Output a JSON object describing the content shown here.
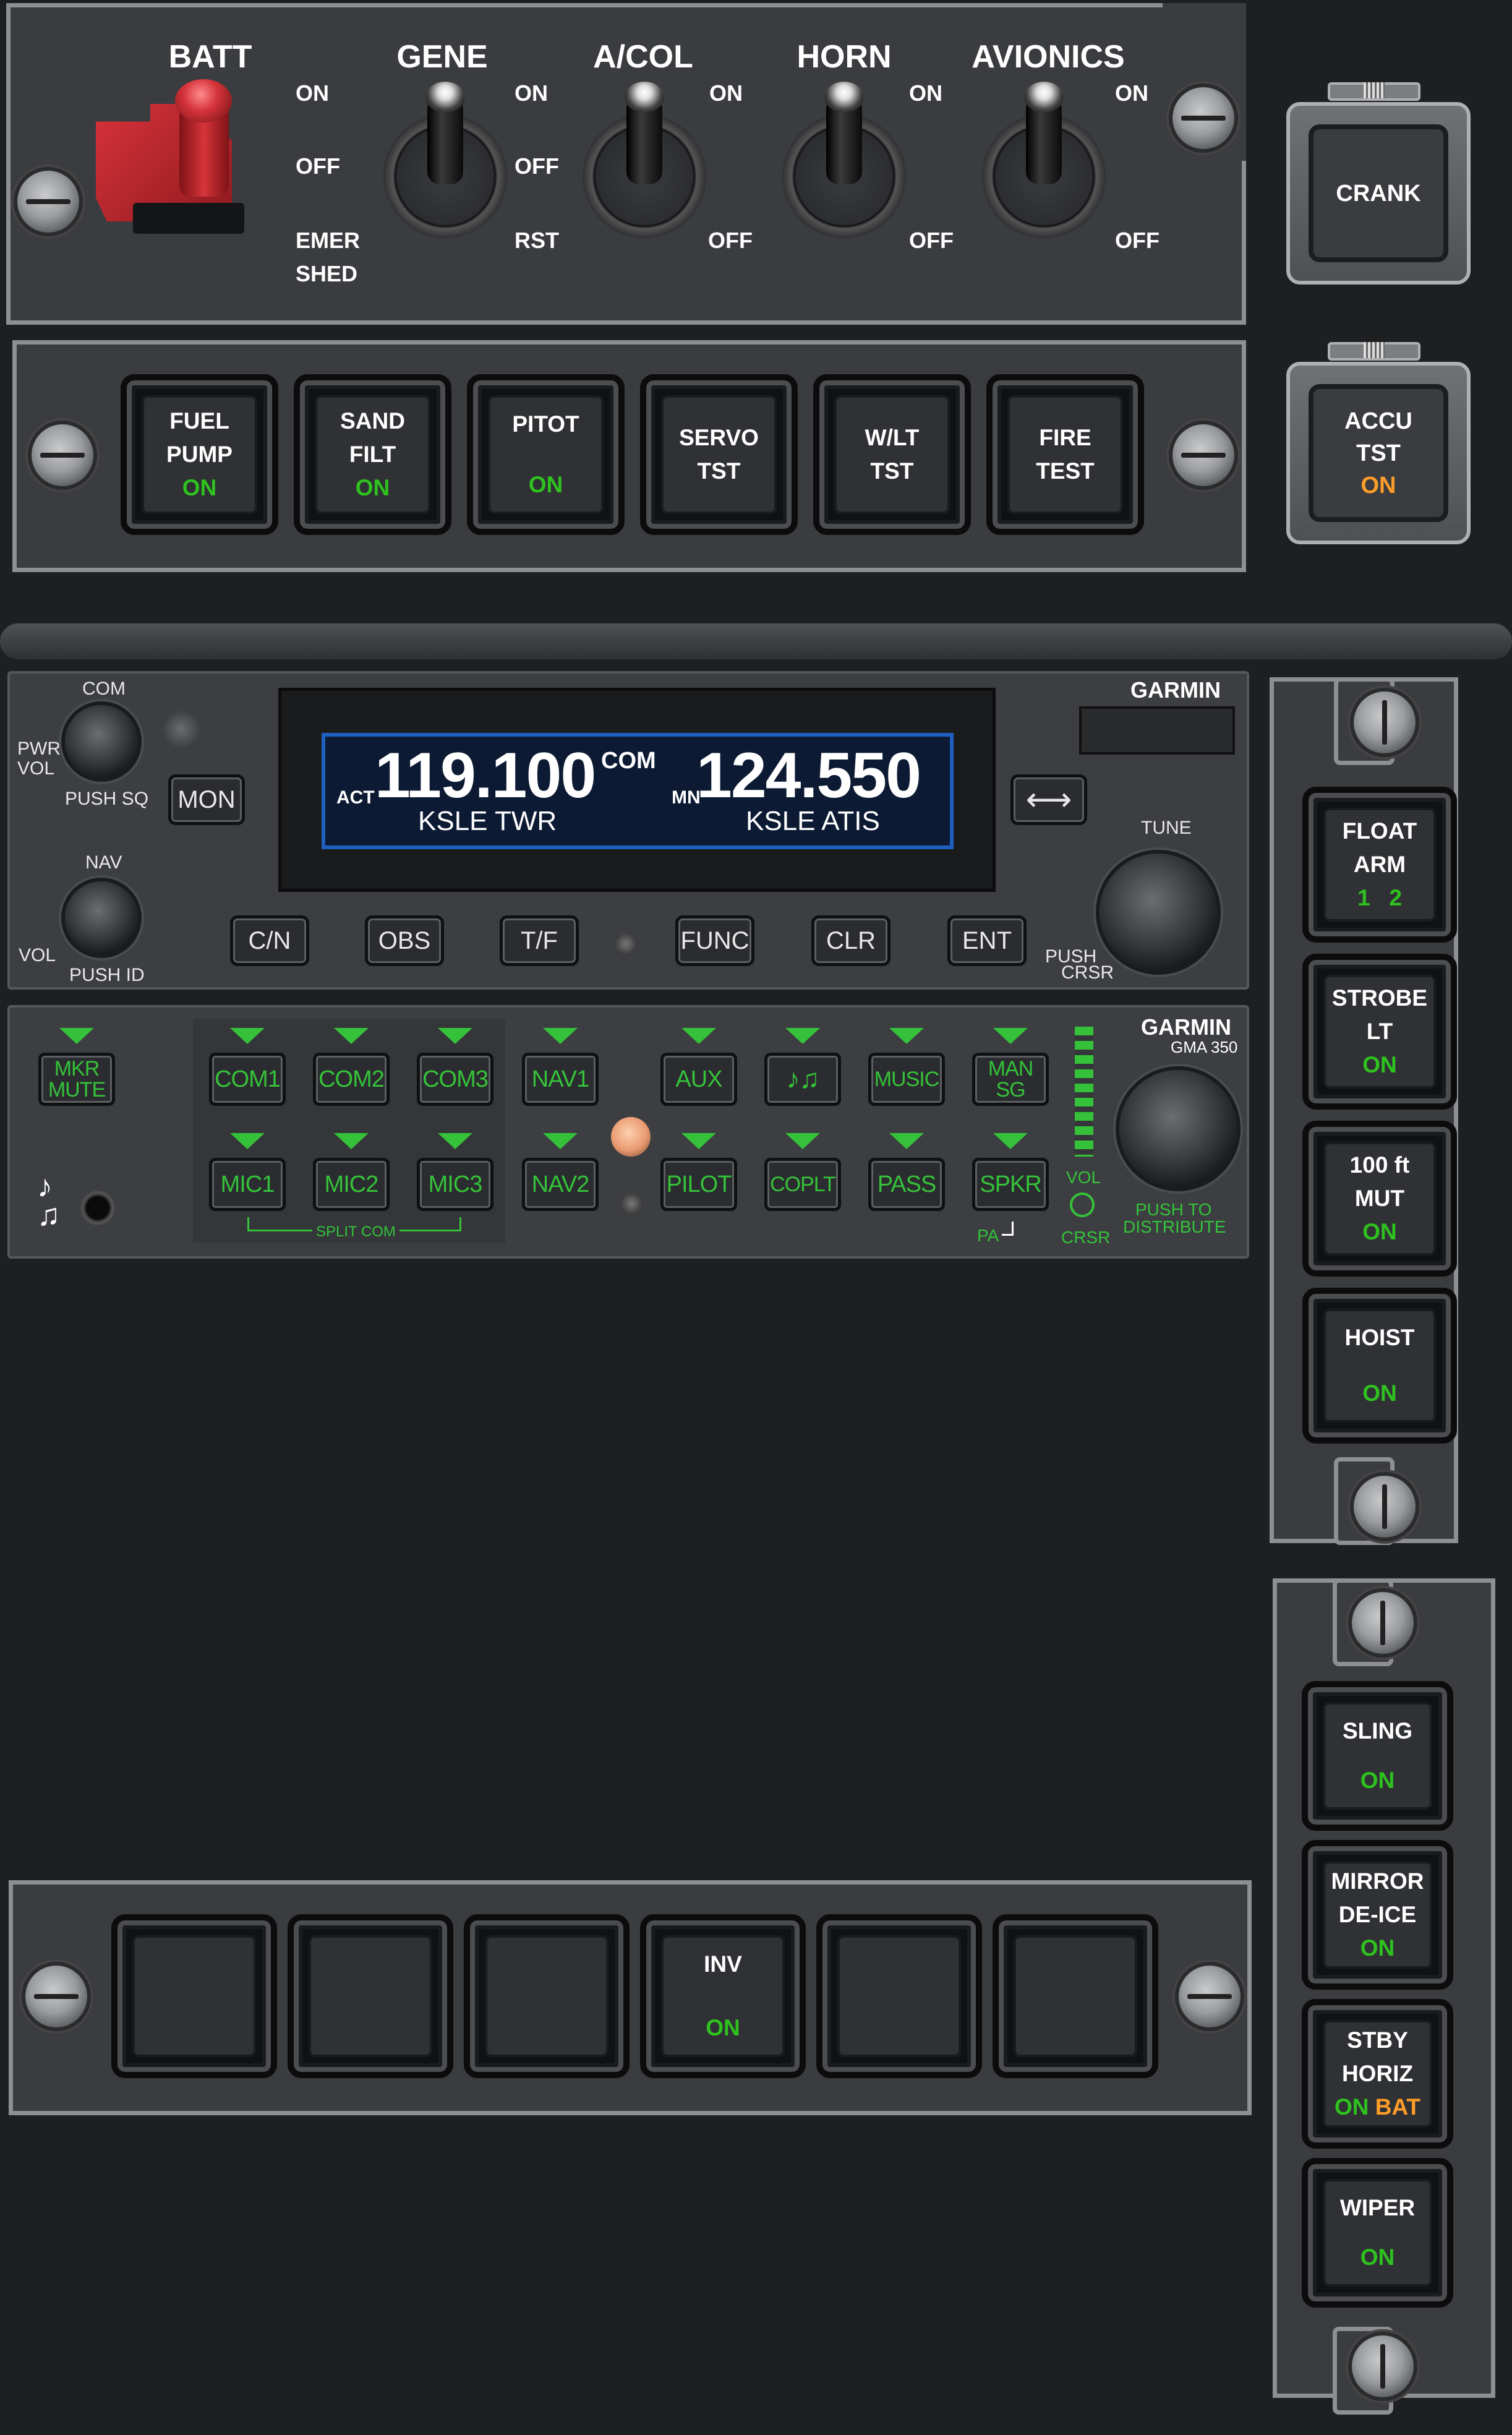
{
  "switch_panel": {
    "titles": [
      "BATT",
      "GENE",
      "A/COL",
      "HORN",
      "AVIONICS"
    ],
    "batt": {
      "on": "ON",
      "off": "OFF",
      "emer": "EMER",
      "shed": "SHED"
    },
    "gene": {
      "on": "ON",
      "off": "OFF",
      "rst": "RST"
    },
    "acol": {
      "on": "ON",
      "off": "OFF"
    },
    "horn": {
      "on": "ON",
      "off": "OFF"
    },
    "avionics": {
      "on": "ON",
      "off": "OFF"
    }
  },
  "crank": {
    "label": "CRANK"
  },
  "accu": {
    "line1": "ACCU",
    "line2": "TST",
    "state": "ON"
  },
  "test_buttons": [
    {
      "line1": "FUEL",
      "line2": "PUMP",
      "state": "ON"
    },
    {
      "line1": "SAND",
      "line2": "FILT",
      "state": "ON"
    },
    {
      "line1": "PITOT",
      "line2": "",
      "state": "ON"
    },
    {
      "line1": "SERVO",
      "line2": "TST",
      "state": ""
    },
    {
      "line1": "W/LT",
      "line2": "TST",
      "state": ""
    },
    {
      "line1": "FIRE",
      "line2": "TEST",
      "state": ""
    }
  ],
  "navcom": {
    "brand": "GARMIN",
    "com_label": "COM",
    "pwr_vol": "PWR\nVOL",
    "push_sq": "PUSH SQ",
    "mon": "MON",
    "nav_label": "NAV",
    "vol": "VOL",
    "push_id": "PUSH ID",
    "act_label": "ACT",
    "active_freq": "119.100",
    "active_station": "KSLE TWR",
    "mode": "COM",
    "stby_label": "MN",
    "standby_freq": "124.550",
    "standby_station": "KSLE ATIS",
    "swap": "⟷",
    "tune": "TUNE",
    "push_crsr_1": "PUSH",
    "push_crsr_2": "CRSR",
    "buttons": [
      "C/N",
      "OBS",
      "T/F",
      "FUNC",
      "CLR",
      "ENT"
    ]
  },
  "audio": {
    "brand": "GARMIN",
    "model": "GMA 350",
    "mkr_mute": "MKR\nMUTE",
    "top_row": [
      "COM1",
      "COM2",
      "COM3",
      "NAV1",
      "AUX",
      "♪♫",
      "MUSIC",
      "MAN\nSG"
    ],
    "bottom_row": [
      "MIC1",
      "MIC2",
      "MIC3",
      "NAV2",
      "PILOT",
      "COPLT",
      "PASS",
      "SPKR"
    ],
    "split_com": "SPLIT COM",
    "pa": "PA",
    "vol": "VOL",
    "crsr": "CRSR",
    "push_to_1": "PUSH TO",
    "push_to_2": "DISTRIBUTE",
    "music_icon": "♪\n♫"
  },
  "side_upper": [
    {
      "line1": "FLOAT",
      "line2": "ARM",
      "state": "1   2"
    },
    {
      "line1": "STROBE",
      "line2": "LT",
      "state": "ON"
    },
    {
      "line1": "100 ft",
      "line2": "MUT",
      "state": "ON"
    },
    {
      "line1": "HOIST",
      "line2": "",
      "state": "ON"
    }
  ],
  "side_lower": [
    {
      "line1": "SLING",
      "line2": "",
      "state": "ON",
      "state2": ""
    },
    {
      "line1": "MIRROR",
      "line2": "DE-ICE",
      "state": "ON",
      "state2": ""
    },
    {
      "line1": "STBY",
      "line2": "HORIZ",
      "state": "ON",
      "state2": "BAT"
    },
    {
      "line1": "WIPER",
      "line2": "",
      "state": "ON",
      "state2": ""
    }
  ],
  "bottom_buttons": [
    {
      "line1": "",
      "state": ""
    },
    {
      "line1": "",
      "state": ""
    },
    {
      "line1": "",
      "state": ""
    },
    {
      "line1": "INV",
      "state": "ON"
    },
    {
      "line1": "",
      "state": ""
    },
    {
      "line1": "",
      "state": ""
    }
  ],
  "colors": {
    "on_green": "#2fc21f",
    "on_orange": "#ff9d2a",
    "audio_green": "#35c23a",
    "lcd_blue": "#0c1a33",
    "batt_red": "#c0232a"
  }
}
